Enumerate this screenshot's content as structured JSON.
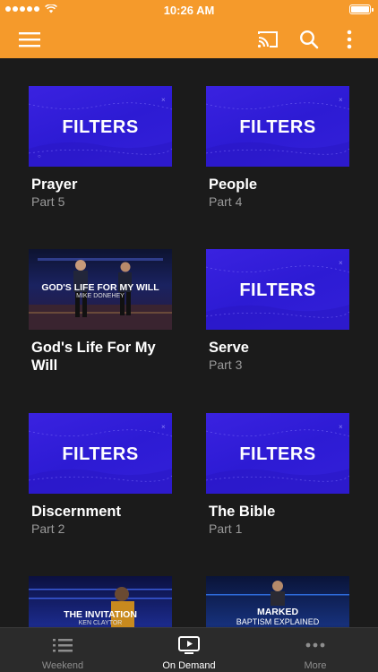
{
  "status_bar": {
    "time": "10:26 AM"
  },
  "cards": [
    {
      "thumb_text": "FILTERS",
      "title": "Prayer",
      "subtitle": "Part 5"
    },
    {
      "thumb_text": "FILTERS",
      "title": "People",
      "subtitle": "Part 4"
    },
    {
      "thumb_text": "GOD'S LIFE FOR MY WILL",
      "thumb_sub": "MIKE DONEHEY",
      "title": "God's Life For My Will",
      "subtitle": ""
    },
    {
      "thumb_text": "FILTERS",
      "title": "Serve",
      "subtitle": "Part 3"
    },
    {
      "thumb_text": "FILTERS",
      "title": "Discernment",
      "subtitle": "Part 2"
    },
    {
      "thumb_text": "FILTERS",
      "title": "The Bible",
      "subtitle": "Part 1"
    },
    {
      "thumb_text": "THE INVITATION",
      "thumb_sub": "KEN CLAYTOR"
    },
    {
      "thumb_text": "MARKED",
      "thumb_sub": "BAPTISM EXPLAINED"
    }
  ],
  "tabs": [
    {
      "label": "Weekend",
      "icon": "list-icon"
    },
    {
      "label": "On Demand",
      "icon": "tv-play-icon"
    },
    {
      "label": "More",
      "icon": "more-dots-icon"
    }
  ],
  "colors": {
    "accent": "#f59a2b",
    "background": "#1b1b1b",
    "thumb_blue": "#3320d8"
  }
}
